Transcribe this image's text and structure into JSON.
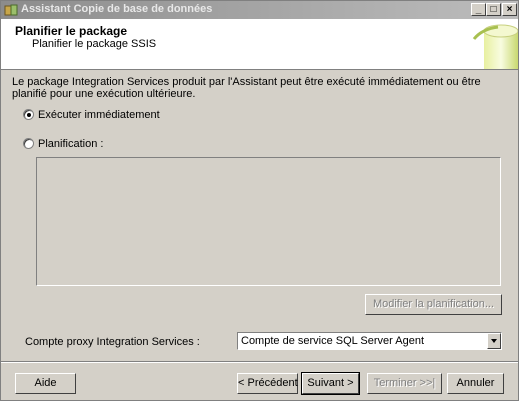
{
  "window": {
    "title": "Assistant Copie de base de données",
    "minimize": "_",
    "maximize": "□",
    "close": "×"
  },
  "header": {
    "title": "Planifier le package",
    "subtitle": "Planifier le package SSIS"
  },
  "description": "Le package Integration Services produit par l'Assistant peut être exécuté immédiatement ou être planifié pour une exécution ultérieure.",
  "options": {
    "run_now": {
      "label": "Exécuter immédiatement",
      "selected": true
    },
    "schedule": {
      "label": "Planification :",
      "selected": false
    }
  },
  "modify_schedule_button": "Modifier la planification...",
  "proxy": {
    "label": "Compte proxy Integration Services :",
    "selected": "Compte de service SQL Server Agent"
  },
  "footer": {
    "help": "Aide",
    "previous": "< Précédent",
    "next": "Suivant >",
    "finish": "Terminer >>|",
    "cancel": "Annuler"
  }
}
